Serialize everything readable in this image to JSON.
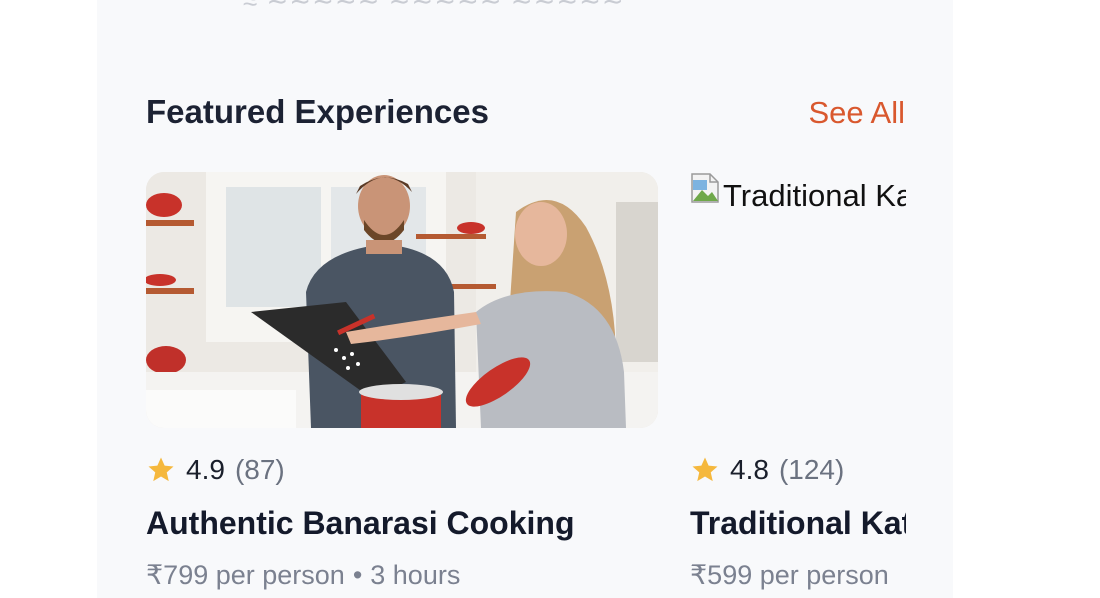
{
  "section": {
    "title": "Featured Experiences",
    "see_all_label": "See All"
  },
  "experiences": [
    {
      "rating": "4.9",
      "reviews": "(87)",
      "title": "Authentic Banarasi Cooking",
      "price": "₹799 per person",
      "separator": "•",
      "duration": "3 hours",
      "image": "cooking-couple-photo"
    },
    {
      "rating": "4.8",
      "reviews": "(124)",
      "title": "Traditional Kat",
      "price": "₹599 per person",
      "image_alt": "Traditional Ka",
      "image": "broken-image-icon"
    }
  ],
  "colors": {
    "accent": "#d9582e",
    "star": "#f5b83d",
    "title": "#1c2233",
    "muted": "#6b7280",
    "panel": "#f8f9fb"
  }
}
